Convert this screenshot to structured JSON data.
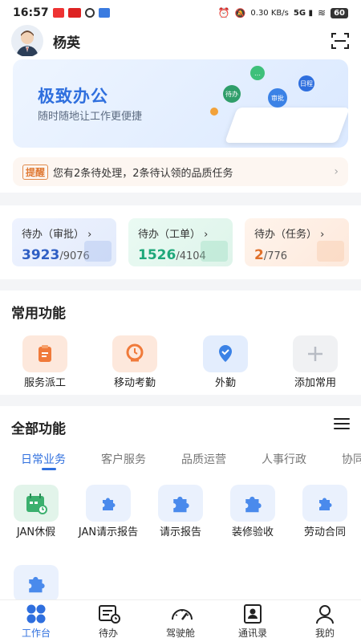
{
  "status_bar": {
    "time": "16:57",
    "network_speed": "0.30 KB/s",
    "battery": "60"
  },
  "header": {
    "user_name": "杨英"
  },
  "banner": {
    "title": "极致办公",
    "subtitle": "随时随地让工作更便捷",
    "bubbles": [
      "待办",
      "审批",
      "日程"
    ]
  },
  "reminder": {
    "tag": "提醒",
    "text": "您有2条待处理，2条待认领的品质任务"
  },
  "todos": [
    {
      "label": "待办（审批）",
      "count": "3923",
      "total": "/9076",
      "color": "#2f5fc4"
    },
    {
      "label": "待办（工单）",
      "count": "1526",
      "total": "/4104",
      "color": "#1ea87a"
    },
    {
      "label": "待办（任务）",
      "count": "2",
      "total": "/776",
      "color": "#e0702a"
    }
  ],
  "common": {
    "title": "常用功能",
    "items": [
      {
        "label": "服务派工",
        "icon": "clipboard-icon"
      },
      {
        "label": "移动考勤",
        "icon": "clock-pin-icon"
      },
      {
        "label": "外勤",
        "icon": "location-check-icon"
      },
      {
        "label": "添加常用",
        "icon": "plus-icon"
      }
    ]
  },
  "all_functions": {
    "title": "全部功能",
    "tabs": [
      "日常业务",
      "客户服务",
      "品质运营",
      "人事行政",
      "协同"
    ],
    "active_tab": 0,
    "items": [
      {
        "label": "JAN休假",
        "icon": "calendar-icon"
      },
      {
        "label": "JAN请示报告",
        "icon": "puzzle-icon"
      },
      {
        "label": "请示报告",
        "icon": "puzzle-icon"
      },
      {
        "label": "装修验收",
        "icon": "puzzle-icon"
      },
      {
        "label": "劳动合同",
        "icon": "puzzle-icon"
      },
      {
        "label": "",
        "icon": "puzzle-icon"
      }
    ]
  },
  "bottom_nav": [
    {
      "label": "工作台",
      "icon": "grid-icon",
      "active": true
    },
    {
      "label": "待办",
      "icon": "todo-list-icon",
      "active": false
    },
    {
      "label": "驾驶舱",
      "icon": "gauge-icon",
      "active": false
    },
    {
      "label": "通讯录",
      "icon": "contacts-icon",
      "active": false
    },
    {
      "label": "我的",
      "icon": "profile-icon",
      "active": false
    }
  ]
}
